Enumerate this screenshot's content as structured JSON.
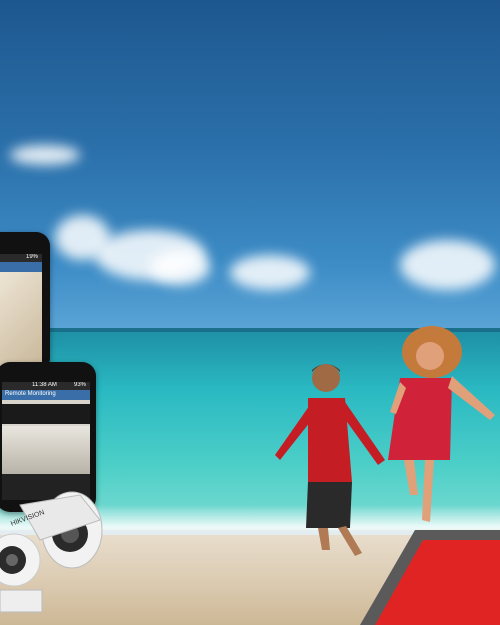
{
  "scene": {
    "colors": {
      "sky": "#2b70aa",
      "sea": "#2ab9c2",
      "sand": "#d9c8ad",
      "accent_red": "#e02424",
      "accent_gray": "#5a5a5a"
    }
  },
  "phone_small": {
    "battery": "93%",
    "title_text": "Remote Monitoring",
    "time": "11:38 AM"
  },
  "phone_large": {
    "battery": "19%"
  },
  "camera": {
    "brand": "HIKVISION"
  }
}
